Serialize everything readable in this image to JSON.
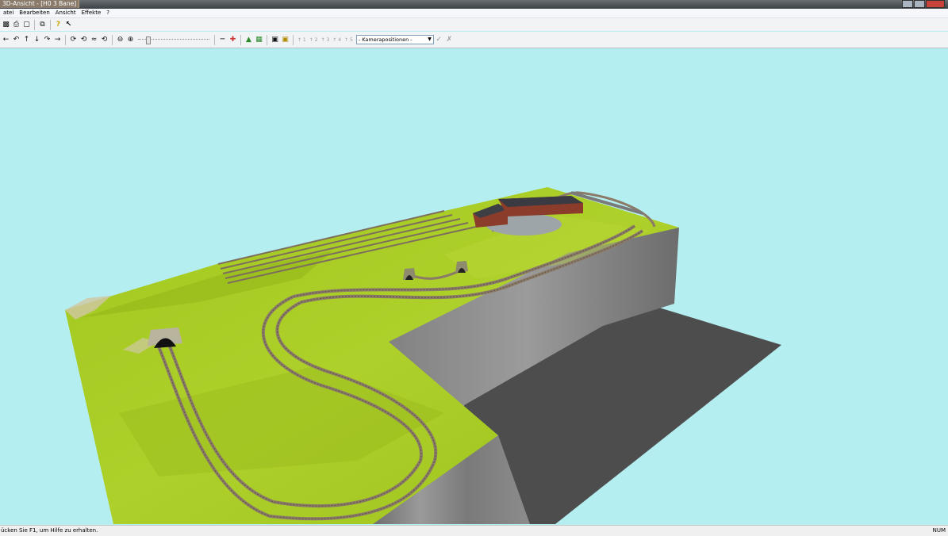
{
  "window": {
    "title": "3D-Ansicht - [H0 3 Bane]"
  },
  "menu": {
    "items": [
      "atei",
      "Bearbeiten",
      "Ansicht",
      "Effekte",
      "?"
    ]
  },
  "toolbar": {
    "camera_positions": [
      "↑ 1",
      "↑ 2",
      "↑ 3",
      "↑ 4",
      "↑ 5"
    ],
    "camera_select": {
      "selected": "- Kamerapositionen -"
    }
  },
  "status": {
    "text": "ücken Sie F1, um Hilfe zu erhalten.",
    "indicator": "NUM"
  },
  "colors": {
    "sky": "#b5eef1",
    "terrain": "#a9cc22",
    "cliff": "#8a8a8a",
    "ground": "#4d4d4d",
    "track": "#8a7a68",
    "building": "#8b3c2a"
  }
}
